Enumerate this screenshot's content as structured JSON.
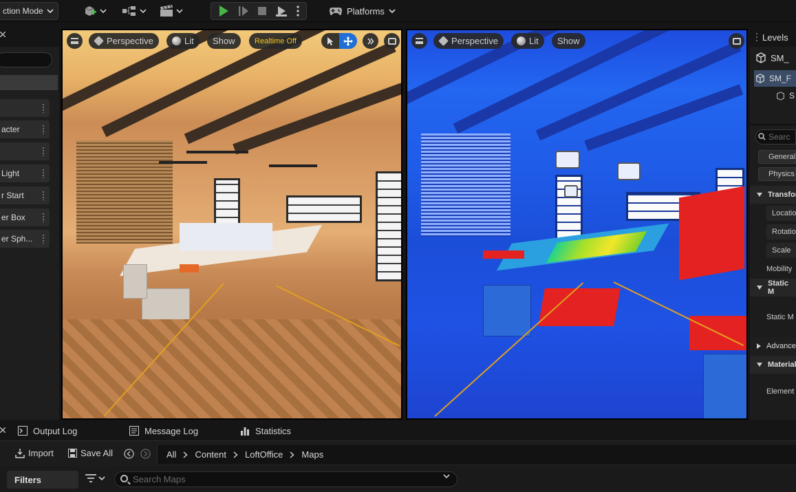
{
  "toolbar": {
    "mode_label": "ction Mode",
    "platforms_label": "Platforms"
  },
  "left_panel": {
    "items": [
      {
        "label": ""
      },
      {
        "label": "acter"
      },
      {
        "label": ""
      },
      {
        "label": "Light"
      },
      {
        "label": "r Start"
      },
      {
        "label": "er Box"
      },
      {
        "label": "er Sph..."
      }
    ]
  },
  "viewport_left": {
    "view_mode": "Perspective",
    "lighting": "Lit",
    "show": "Show",
    "realtime": "Realtime Off"
  },
  "viewport_right": {
    "view_mode": "Perspective",
    "lighting": "Lit",
    "show": "Show"
  },
  "right_panel": {
    "tab": "Levels",
    "outliner": [
      "SM_",
      "SM_F",
      "S"
    ],
    "search_placeholder": "Searc",
    "chips": [
      "General",
      "Physics"
    ],
    "sections": [
      "Transfor",
      "Static M",
      "Advance",
      "Material"
    ],
    "props": [
      "Locatio",
      "Rotatio",
      "Scale"
    ],
    "labels": {
      "mobility": "Mobility",
      "static": "Static M",
      "element": "Element"
    }
  },
  "bottom_tabs": [
    "Output Log",
    "Message Log",
    "Statistics"
  ],
  "content_browser": {
    "import": "Import",
    "save_all": "Save All",
    "breadcrumb": [
      "All",
      "Content",
      "LoftOffice",
      "Maps"
    ],
    "filters": "Filters",
    "search_placeholder": "Search Maps"
  }
}
